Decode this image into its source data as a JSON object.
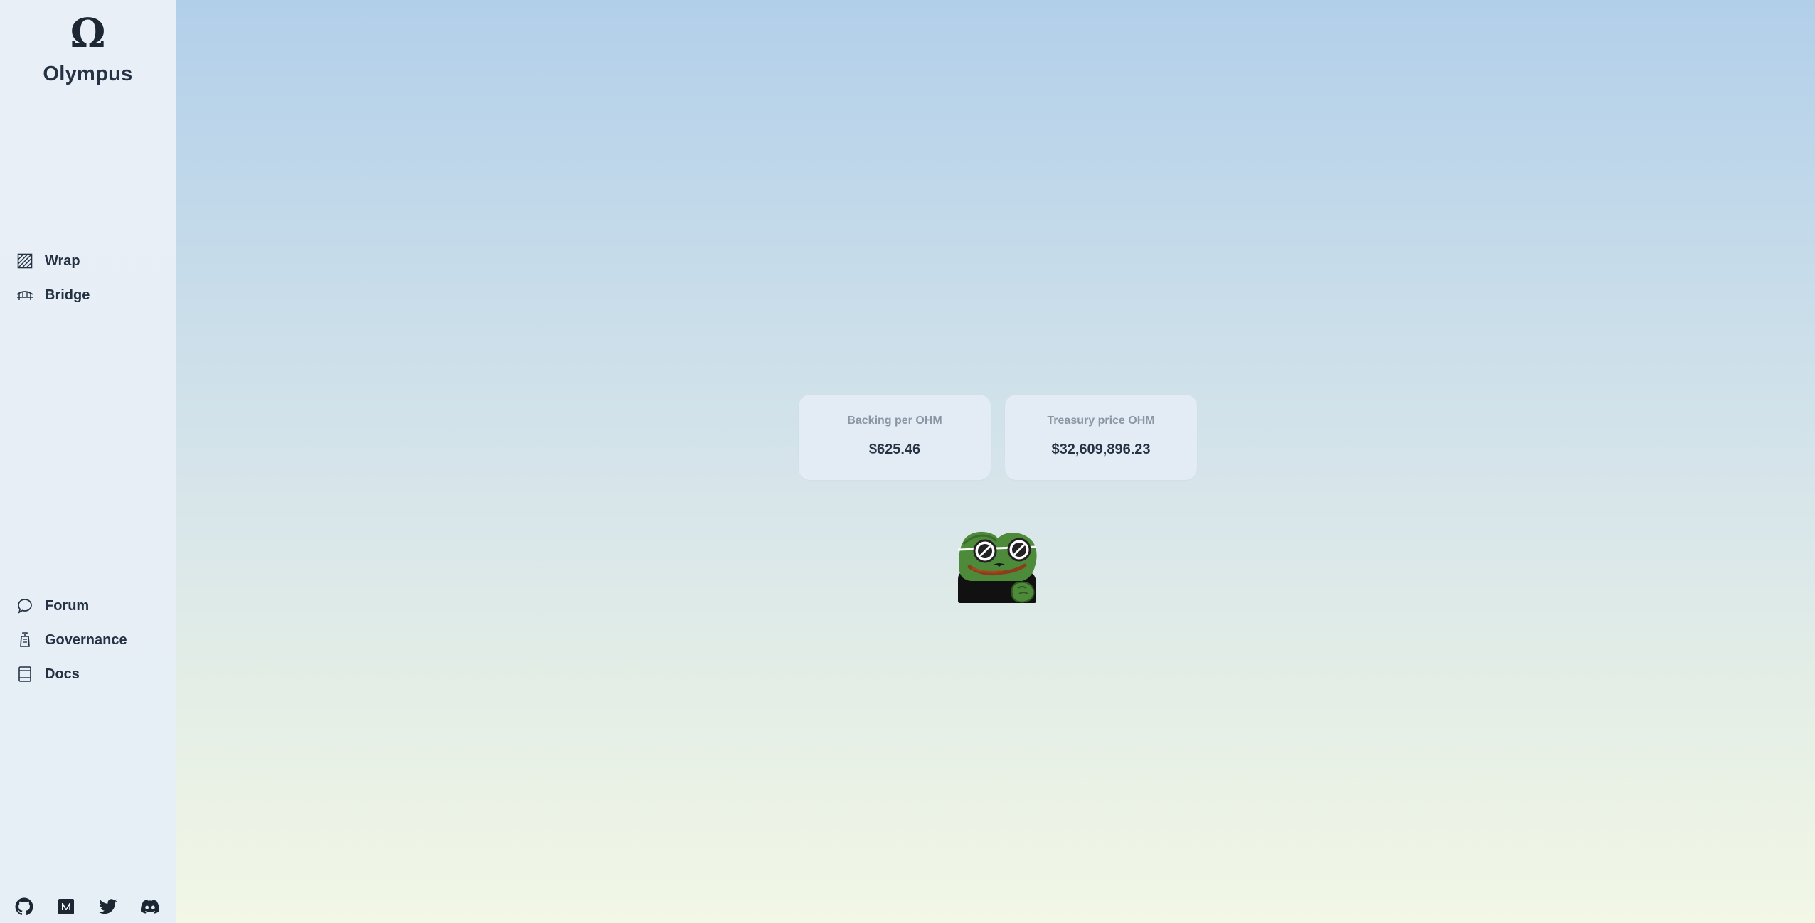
{
  "brand": {
    "name": "Olympus",
    "logo_icon": "omega-icon",
    "logo_glyph": "Ω"
  },
  "sidebar": {
    "top_items": [
      {
        "label": "Wrap",
        "icon": "wrap-icon"
      },
      {
        "label": "Bridge",
        "icon": "bridge-icon"
      }
    ],
    "bottom_items": [
      {
        "label": "Forum",
        "icon": "chat-bubble-icon"
      },
      {
        "label": "Governance",
        "icon": "governance-icon"
      },
      {
        "label": "Docs",
        "icon": "docs-icon"
      }
    ],
    "socials": [
      "github-icon",
      "medium-icon",
      "twitter-icon",
      "discord-icon"
    ]
  },
  "stats": [
    {
      "label": "Backing per OHM",
      "value": "$625.46"
    },
    {
      "label": "Treasury price OHM",
      "value": "$32,609,896.23"
    }
  ],
  "mascot": "pepe-sunglasses-image",
  "colors": {
    "text_primary": "#253244",
    "text_muted": "#8a96a4",
    "card_bg": "#e3ecf5",
    "sidebar_bg": "#e8eff6",
    "bg_top": "#b2cfea",
    "bg_bottom": "#f2f7e6"
  }
}
